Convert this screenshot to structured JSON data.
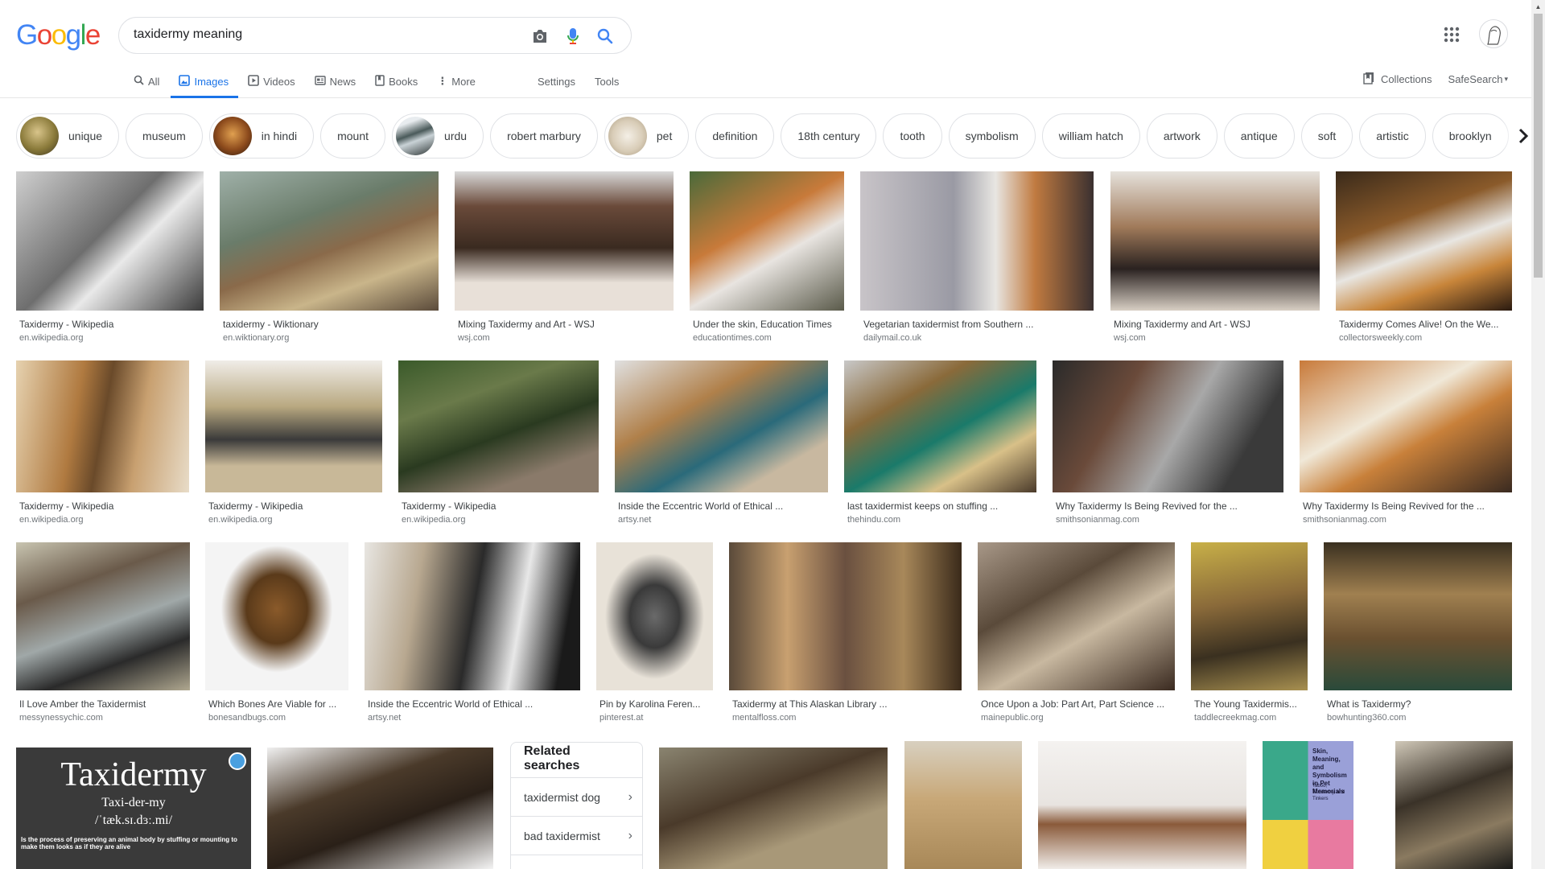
{
  "search": {
    "query": "taxidermy meaning"
  },
  "logo_text": "Google",
  "tabs": [
    {
      "label": "All",
      "icon": "search-icon"
    },
    {
      "label": "Images",
      "icon": "image-icon"
    },
    {
      "label": "Videos",
      "icon": "video-icon"
    },
    {
      "label": "News",
      "icon": "news-icon"
    },
    {
      "label": "Books",
      "icon": "book-icon"
    },
    {
      "label": "More",
      "icon": "more-vert-icon"
    }
  ],
  "tools_links": {
    "settings": "Settings",
    "tools": "Tools"
  },
  "right_links": {
    "collections": "Collections",
    "safesearch": "SafeSearch"
  },
  "chips": [
    "unique",
    "museum",
    "in hindi",
    "mount",
    "urdu",
    "robert marbury",
    "pet",
    "definition",
    "18th century",
    "tooth",
    "symbolism",
    "william hatch",
    "artwork",
    "antique",
    "soft",
    "artistic",
    "brooklyn"
  ],
  "results": [
    {
      "title": "Taxidermy - Wikipedia",
      "site": "en.wikipedia.org"
    },
    {
      "title": "taxidermy - Wiktionary",
      "site": "en.wiktionary.org"
    },
    {
      "title": "Mixing Taxidermy and Art - WSJ",
      "site": "wsj.com"
    },
    {
      "title": "Under the skin, Education Times",
      "site": "educationtimes.com"
    },
    {
      "title": "Vegetarian taxidermist from Southern ...",
      "site": "dailymail.co.uk"
    },
    {
      "title": "Mixing Taxidermy and Art - WSJ",
      "site": "wsj.com"
    },
    {
      "title": "Taxidermy Comes Alive! On the We...",
      "site": "collectorsweekly.com"
    },
    {
      "title": "Taxidermy - Wikipedia",
      "site": "en.wikipedia.org"
    },
    {
      "title": "Taxidermy - Wikipedia",
      "site": "en.wikipedia.org"
    },
    {
      "title": "Taxidermy - Wikipedia",
      "site": "en.wikipedia.org"
    },
    {
      "title": "Inside the Eccentric World of Ethical ...",
      "site": "artsy.net"
    },
    {
      "title": "last taxidermist keeps on stuffing ...",
      "site": "thehindu.com"
    },
    {
      "title": "Why Taxidermy Is Being Revived for the ...",
      "site": "smithsonianmag.com"
    },
    {
      "title": "Why Taxidermy Is Being Revived for the ...",
      "site": "smithsonianmag.com"
    },
    {
      "title": "Il Love Amber the Taxidermist",
      "site": "messynessychic.com"
    },
    {
      "title": "Which Bones Are Viable for ...",
      "site": "bonesandbugs.com"
    },
    {
      "title": "Inside the Eccentric World of Ethical ...",
      "site": "artsy.net"
    },
    {
      "title": "Pin by Karolina Feren...",
      "site": "pinterest.at"
    },
    {
      "title": "Taxidermy at This Alaskan Library ...",
      "site": "mentalfloss.com"
    },
    {
      "title": "Once Upon a Job: Part Art, Part Science ...",
      "site": "mainepublic.org"
    },
    {
      "title": "The Young Taxidermis...",
      "site": "taddlecreekmag.com"
    },
    {
      "title": "What is Taxidermy?",
      "site": "bowhunting360.com"
    }
  ],
  "taxidermy_card": {
    "word": "Taxidermy",
    "syllables": "Taxi-der-my",
    "ipa": "/ˈtæk.sɪ.dɜː.mi/",
    "definition": "Is the process of preserving an animal body by stuffing or mounting to make them looks as if they are alive"
  },
  "book_cover": {
    "title": "Skin, Meaning, and Symbolism in Pet Memorials",
    "subtitle": "Taboo, Taxidermy, and Tinkers"
  },
  "related": {
    "heading": "Related searches",
    "items": [
      "taxidermist dog",
      "bad taxidermist"
    ]
  },
  "colors": {
    "accent": "#1a73e8",
    "text": "#3c4043",
    "muted": "#70757a",
    "border": "#dfe1e5"
  }
}
